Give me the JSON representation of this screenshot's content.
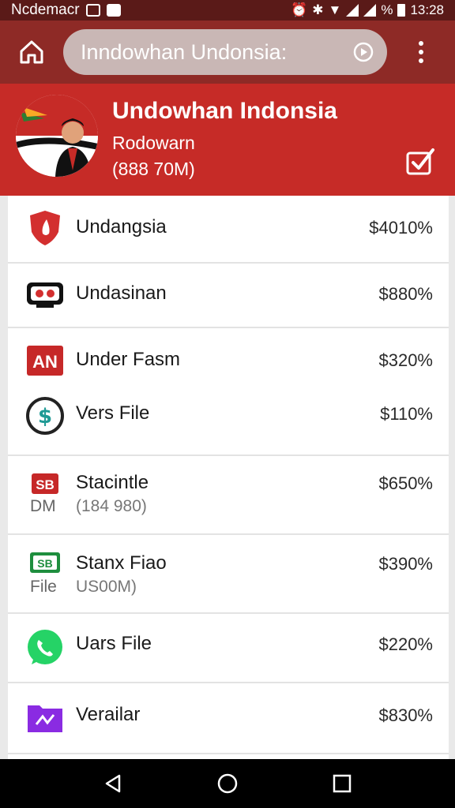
{
  "status_bar": {
    "carrier": "Ncdemacr",
    "time": "13:28",
    "battery": "%"
  },
  "browser": {
    "url_text": "Inndowhan Undonsia:"
  },
  "profile": {
    "title": "Undowhan Indonsia",
    "subtitle": "Rodowarn",
    "meta": "(888 70M)"
  },
  "items": [
    {
      "title": "Undangsia",
      "value": "$4010%",
      "icon": "shield-icon",
      "color": "#d32f2f"
    },
    {
      "title": "Undasinan",
      "value": "$880%",
      "icon": "cassette-icon",
      "color": "#111111"
    },
    {
      "title": "Under Fasm",
      "value": "$320%",
      "icon": "an-badge-icon",
      "icon_text": "AN",
      "color": "#c62828"
    },
    {
      "title": "Vers File",
      "value": "$110%",
      "icon": "coin-icon",
      "color": "#1f9a95"
    },
    {
      "title": "Stacintle",
      "value": "$650%",
      "sub": "(184 980)",
      "tag": "DM",
      "icon": "sb-badge-icon",
      "icon_text": "SB",
      "color": "#c62828"
    },
    {
      "title": "Stanx Fiao",
      "value": "$390%",
      "sub": "US00M)",
      "tag": "File",
      "icon": "money-icon",
      "icon_text": "SB",
      "color": "#1e8e3e"
    },
    {
      "title": "Uars File",
      "value": "$220%",
      "icon": "whatsapp-icon",
      "color": "#25d366"
    },
    {
      "title": "Verailar",
      "value": "$830%",
      "icon": "folder-icon",
      "color": "#8a2be2"
    }
  ]
}
